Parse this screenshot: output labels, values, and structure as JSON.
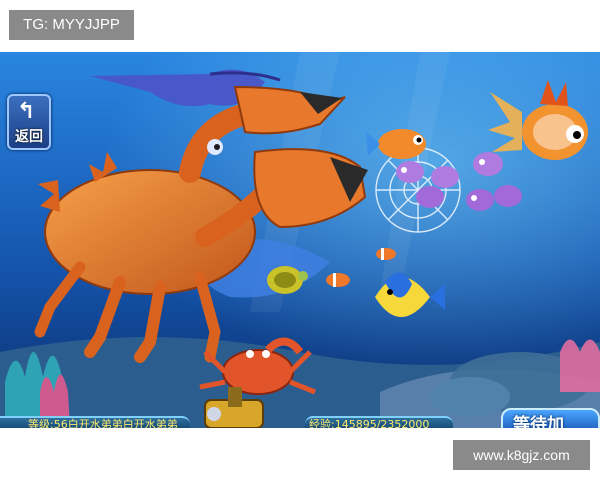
{
  "overlay": {
    "top_tag": "TG: MYYJJPP",
    "bottom_tag": "www.k8gjz.com"
  },
  "game": {
    "back_button_label": "返回",
    "player_info": "等级:56白开水弟弟白开水弟弟",
    "coin_counter": "经验:145895/2352000",
    "action_button_label": "等待加"
  },
  "colors": {
    "ocean_top": "#1e6fc9",
    "ocean_bottom": "#0a2f6b",
    "crab": "#e07a2a",
    "accent_yellow": "#ffe96b"
  }
}
